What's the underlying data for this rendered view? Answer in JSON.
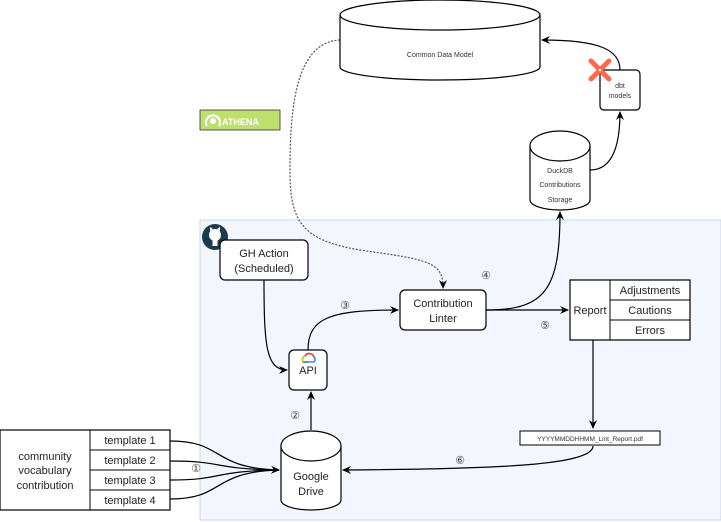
{
  "nodes": {
    "cdm": "Common Data Model",
    "dbt": [
      "dbt",
      "models"
    ],
    "duckdb": [
      "DuckDB",
      "Contributions",
      "Storage"
    ],
    "athena": "ATHENA",
    "gh_action": [
      "GH Action",
      "(Scheduled)"
    ],
    "linter": [
      "Contribution",
      "Linter"
    ],
    "api": "API",
    "report": {
      "label": "Report",
      "rows": [
        "Adjustments",
        "Cautions",
        "Errors"
      ]
    },
    "pdf": "YYYYMMDDHHMM_Lint_Report.pdf",
    "drive": [
      "Google",
      "Drive"
    ],
    "community": {
      "label": [
        "community",
        "vocabulary",
        "contribution"
      ],
      "templates": [
        "template 1",
        "template 2",
        "template 3",
        "template 4"
      ]
    }
  },
  "steps": [
    "①",
    "②",
    "③",
    "④",
    "⑤",
    "⑥"
  ],
  "colors": {
    "region_fill": "#f3f6fd",
    "region_stroke": "#c9d7ee",
    "athena": "#bde06e",
    "dbt": "#ff694b",
    "github": "#1b3a4b"
  }
}
